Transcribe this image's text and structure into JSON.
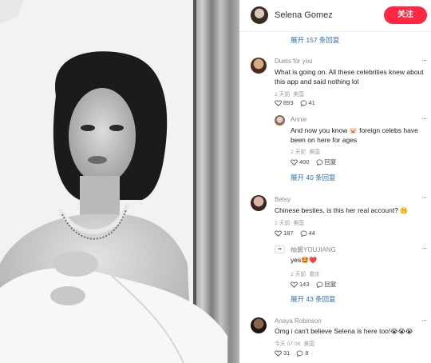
{
  "header": {
    "author_name": "Selena Gomez",
    "follow_label": "关注"
  },
  "top_expand": "展开 157 条回复",
  "comments": [
    {
      "user": "Duets for you",
      "text": "What is going on. All these celebrities knew about this app and said nothing lol",
      "time": "2 天前",
      "location": "美国",
      "likes": "893",
      "replies": "41",
      "more": "···",
      "reply": {
        "user": "Annie",
        "text_before": "And now you know",
        "emoji": "🐷",
        "text_after": "foreign celebs have been on here for ages",
        "time": "2 天前",
        "location": "美国",
        "likes": "400",
        "reply_label": "回复",
        "more": "···"
      },
      "expand": "展开 40 条回复"
    },
    {
      "user": "Betsy",
      "text": "Chinese besties, is this her real account?",
      "emoji": "🤫",
      "time": "2 天前",
      "location": "美国",
      "likes": "187",
      "replies": "44",
      "more": "···",
      "reply": {
        "user": "柚酱YOUJIANG",
        "text": "yes",
        "emoji": "🤩❤️",
        "time": "2 天前",
        "location": "重庆",
        "likes": "143",
        "reply_label": "回复",
        "more": "···"
      },
      "expand": "展开 43 条回复"
    },
    {
      "user": "Anaya Robinson",
      "text": "Omg i can't believe Selena is here too!",
      "emoji": "😭😭😭",
      "time": "今天 07:06",
      "location": "美国",
      "likes": "31",
      "replies": "8",
      "more": "···"
    }
  ],
  "icons": {
    "like": "heart-outline-icon",
    "comment": "speech-bubble-icon",
    "more": "more-dots-icon"
  },
  "colors": {
    "follow_button": "#ff2741",
    "link": "#2f6fb8",
    "meta_text": "#9a9a9a"
  }
}
